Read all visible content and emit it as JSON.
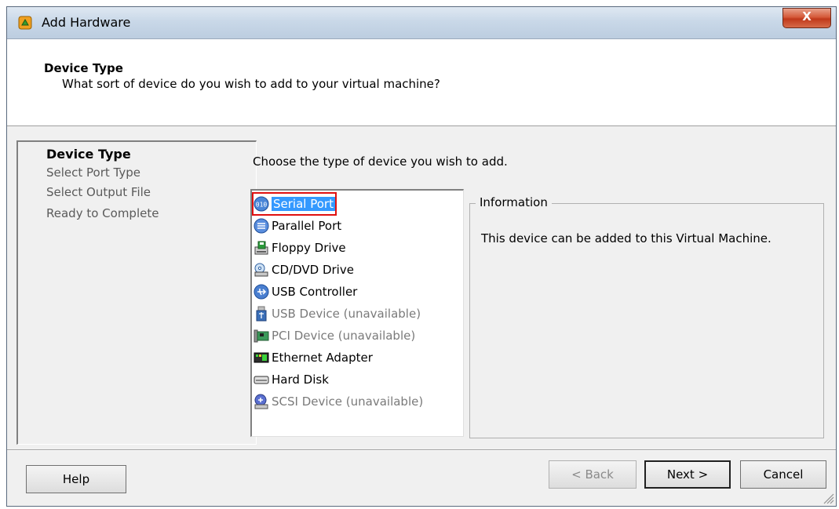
{
  "window": {
    "title": "Add Hardware",
    "close_label": "X"
  },
  "header": {
    "title": "Device Type",
    "subtitle": "What sort of device do you wish to add to your virtual machine?"
  },
  "steps": [
    {
      "label": "Device Type",
      "active": true
    },
    {
      "label": "Select Port Type",
      "active": false
    },
    {
      "label": "Select Output File",
      "active": false
    },
    {
      "label": "Ready to Complete",
      "active": false
    }
  ],
  "main": {
    "prompt": "Choose the type of device you wish to add.",
    "devices": [
      {
        "label": "Serial Port",
        "icon": "serial-port-icon",
        "selected": true,
        "available": true
      },
      {
        "label": "Parallel Port",
        "icon": "parallel-port-icon",
        "selected": false,
        "available": true
      },
      {
        "label": "Floppy Drive",
        "icon": "floppy-drive-icon",
        "selected": false,
        "available": true
      },
      {
        "label": "CD/DVD Drive",
        "icon": "cd-dvd-drive-icon",
        "selected": false,
        "available": true
      },
      {
        "label": "USB Controller",
        "icon": "usb-controller-icon",
        "selected": false,
        "available": true
      },
      {
        "label": "USB Device (unavailable)",
        "icon": "usb-device-icon",
        "selected": false,
        "available": false
      },
      {
        "label": "PCI Device (unavailable)",
        "icon": "pci-device-icon",
        "selected": false,
        "available": false
      },
      {
        "label": "Ethernet Adapter",
        "icon": "ethernet-adapter-icon",
        "selected": false,
        "available": true
      },
      {
        "label": "Hard Disk",
        "icon": "hard-disk-icon",
        "selected": false,
        "available": true
      },
      {
        "label": "SCSI Device (unavailable)",
        "icon": "scsi-device-icon",
        "selected": false,
        "available": false
      }
    ],
    "info": {
      "legend": "Information",
      "text": "This device can be added to this Virtual Machine."
    }
  },
  "footer": {
    "help_label": "Help",
    "back_label": "< Back",
    "next_label": "Next >",
    "cancel_label": "Cancel"
  },
  "colors": {
    "selection": "#3399ff",
    "highlight_outline": "#e01010"
  }
}
